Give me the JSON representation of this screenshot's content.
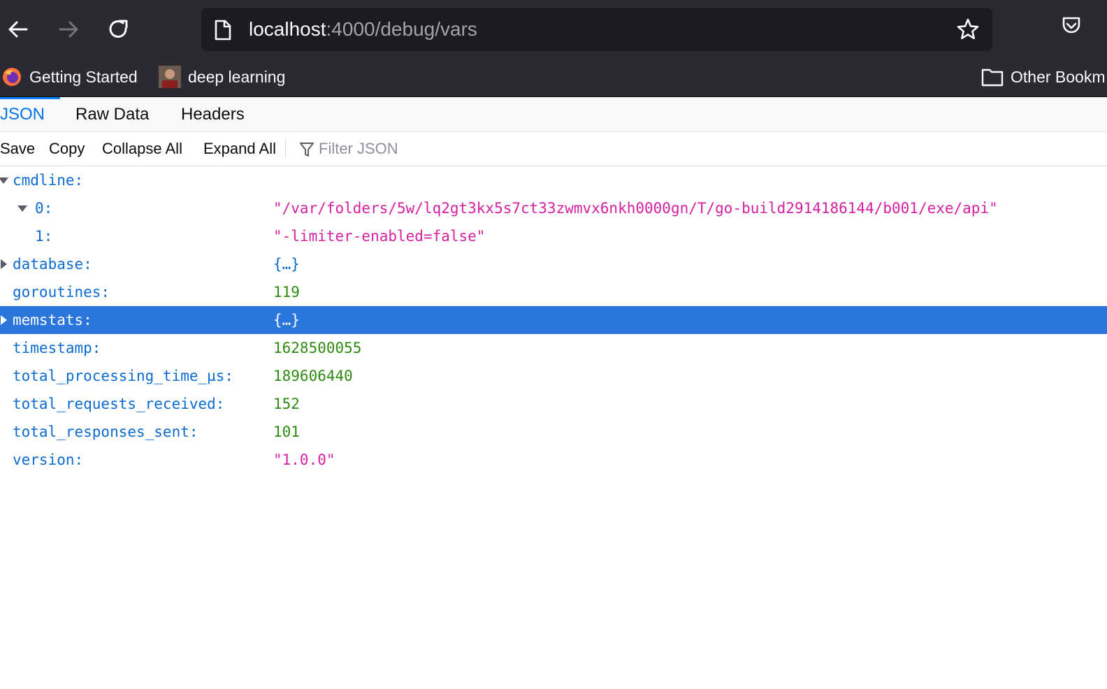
{
  "browser": {
    "url_host": "localhost",
    "url_rest": ":4000/debug/vars",
    "icons": {
      "back": "back-arrow-icon",
      "forward": "forward-arrow-icon",
      "reload": "reload-icon",
      "page": "page-icon",
      "star": "star-icon",
      "pocket": "pocket-icon"
    }
  },
  "bookmarks": {
    "items": [
      {
        "label": "Getting Started",
        "icon": "firefox-icon"
      },
      {
        "label": "deep learning",
        "icon": "avatar-thumbnail"
      }
    ],
    "other": {
      "label": "Other Bookm",
      "icon": "folder-icon"
    }
  },
  "viewer": {
    "tabs": [
      "JSON",
      "Raw Data",
      "Headers"
    ],
    "selected_tab": "JSON",
    "toolbar": {
      "save": "Save",
      "copy": "Copy",
      "collapse_all": "Collapse All",
      "expand_all": "Expand All",
      "filter_placeholder": "Filter JSON"
    },
    "rows": [
      {
        "key": "cmdline:",
        "value": "",
        "type": "",
        "expanded": true,
        "twisty": true,
        "depth": 0
      },
      {
        "key": "0:",
        "value": "\"/var/folders/5w/lq2gt3kx5s7ct33zwmvx6nkh0000gn/T/go-build2914186144/b001/exe/api\"",
        "type": "str",
        "expanded": true,
        "twisty": true,
        "depth": 1
      },
      {
        "key": "1:",
        "value": "\"-limiter-enabled=false\"",
        "type": "str",
        "twisty": false,
        "depth": 1
      },
      {
        "key": "database:",
        "value": "{…}",
        "type": "obj",
        "expanded": false,
        "twisty": true,
        "depth": 0
      },
      {
        "key": "goroutines:",
        "value": "119",
        "type": "num",
        "twisty": false,
        "depth": 0
      },
      {
        "key": "memstats:",
        "value": "{…}",
        "type": "obj",
        "expanded": false,
        "twisty": true,
        "depth": 0,
        "selected": true
      },
      {
        "key": "timestamp:",
        "value": "1628500055",
        "type": "num",
        "twisty": false,
        "depth": 0
      },
      {
        "key": "total_processing_time_µs:",
        "value": "189606440",
        "type": "num",
        "twisty": false,
        "depth": 0
      },
      {
        "key": "total_requests_received:",
        "value": "152",
        "type": "num",
        "twisty": false,
        "depth": 0
      },
      {
        "key": "total_responses_sent:",
        "value": "101",
        "type": "num",
        "twisty": false,
        "depth": 0
      },
      {
        "key": "version:",
        "value": "\"1.0.0\"",
        "type": "str",
        "twisty": false,
        "depth": 0
      }
    ]
  },
  "colors": {
    "chrome_bg": "#2b2a33",
    "urlbar_bg": "#1c1b22",
    "accent": "#0a84ff",
    "selected_row": "#2a76dd",
    "key": "#0b6bd1",
    "string": "#d61fa0",
    "number": "#2e8b10"
  }
}
